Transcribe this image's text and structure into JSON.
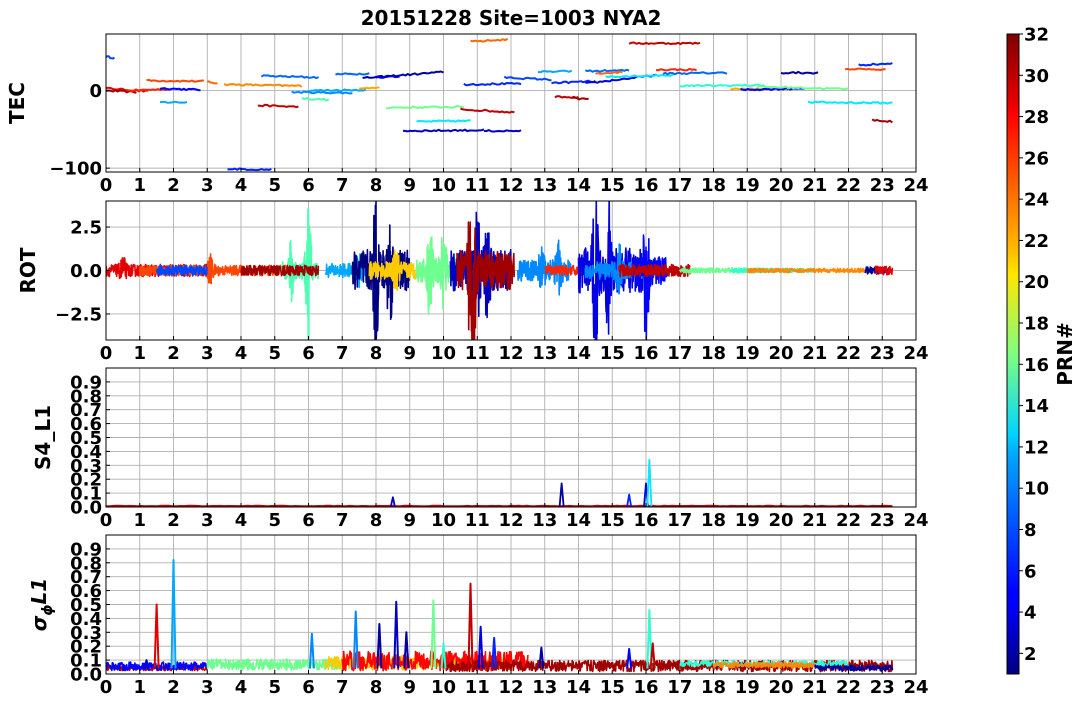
{
  "title": "20151228 Site=1003 NYA2",
  "colorbar": {
    "label": "PRN#",
    "min": 1,
    "max": 32,
    "ticks": [
      2,
      4,
      6,
      8,
      10,
      12,
      14,
      16,
      18,
      20,
      22,
      24,
      26,
      28,
      30,
      32
    ],
    "colormap": "jet"
  },
  "chart_data": [
    {
      "type": "line",
      "id": "tec",
      "ylabel": "TEC",
      "xlim": [
        0,
        24
      ],
      "ylim": [
        -105,
        73
      ],
      "xticks": [
        0,
        1,
        2,
        3,
        4,
        5,
        6,
        7,
        8,
        9,
        10,
        11,
        12,
        13,
        14,
        15,
        16,
        17,
        18,
        19,
        20,
        21,
        22,
        23,
        24
      ],
      "yticks": [
        -100,
        0
      ],
      "grid": true,
      "segments": [
        {
          "prn": 7,
          "x": [
            0.0,
            0.25
          ],
          "y": [
            44,
            42
          ]
        },
        {
          "prn": 29,
          "x": [
            0.0,
            1.25
          ],
          "y": [
            3,
            -1
          ]
        },
        {
          "prn": 31,
          "x": [
            0.0,
            0.9
          ],
          "y": [
            0,
            -2
          ]
        },
        {
          "prn": 27,
          "x": [
            0.6,
            1.9
          ],
          "y": [
            0,
            2
          ]
        },
        {
          "prn": 26,
          "x": [
            1.2,
            2.9
          ],
          "y": [
            13,
            12
          ]
        },
        {
          "prn": 10,
          "x": [
            1.6,
            2.4
          ],
          "y": [
            -15,
            -15
          ]
        },
        {
          "prn": 5,
          "x": [
            1.6,
            2.8
          ],
          "y": [
            3,
            1
          ]
        },
        {
          "prn": 25,
          "x": [
            3.0,
            3.3
          ],
          "y": [
            11,
            10
          ]
        },
        {
          "prn": 24,
          "x": [
            3.5,
            5.8
          ],
          "y": [
            8,
            6
          ]
        },
        {
          "prn": 6,
          "x": [
            3.6,
            4.9
          ],
          "y": [
            -101,
            -102
          ]
        },
        {
          "prn": 30,
          "x": [
            4.5,
            5.7
          ],
          "y": [
            -19,
            -21
          ]
        },
        {
          "prn": 8,
          "x": [
            4.6,
            6.3
          ],
          "y": [
            19,
            17
          ]
        },
        {
          "prn": 9,
          "x": [
            5.5,
            7.3
          ],
          "y": [
            -2,
            -3
          ]
        },
        {
          "prn": 15,
          "x": [
            5.8,
            6.6
          ],
          "y": [
            -10,
            -12
          ]
        },
        {
          "prn": 8,
          "x": [
            6.8,
            7.8
          ],
          "y": [
            21,
            22
          ]
        },
        {
          "prn": 10,
          "x": [
            6.0,
            7.7
          ],
          "y": [
            0,
            1
          ]
        },
        {
          "prn": 23,
          "x": [
            7.5,
            8.1
          ],
          "y": [
            2,
            5
          ]
        },
        {
          "prn": 2,
          "x": [
            7.6,
            10.0
          ],
          "y": [
            16,
            24
          ]
        },
        {
          "prn": 4,
          "x": [
            8.0,
            8.7
          ],
          "y": [
            17,
            18
          ]
        },
        {
          "prn": 16,
          "x": [
            8.3,
            10.6
          ],
          "y": [
            -22,
            -21
          ]
        },
        {
          "prn": 3,
          "x": [
            8.8,
            11.2
          ],
          "y": [
            -52,
            -51
          ]
        },
        {
          "prn": 12,
          "x": [
            9.2,
            10.8
          ],
          "y": [
            -40,
            -39
          ]
        },
        {
          "prn": 30,
          "x": [
            10.5,
            12.1
          ],
          "y": [
            -24,
            -28
          ]
        },
        {
          "prn": 6,
          "x": [
            10.6,
            12.3
          ],
          "y": [
            8,
            9
          ]
        },
        {
          "prn": 25,
          "x": [
            10.8,
            11.9
          ],
          "y": [
            63,
            66
          ]
        },
        {
          "prn": 3,
          "x": [
            11.2,
            12.3
          ],
          "y": [
            -52,
            -52
          ]
        },
        {
          "prn": 7,
          "x": [
            11.8,
            13.2
          ],
          "y": [
            17,
            14
          ]
        },
        {
          "prn": 10,
          "x": [
            12.8,
            13.8
          ],
          "y": [
            24,
            25
          ]
        },
        {
          "prn": 30,
          "x": [
            13.3,
            14.0
          ],
          "y": [
            -8,
            -9
          ]
        },
        {
          "prn": 6,
          "x": [
            13.2,
            14.5
          ],
          "y": [
            10,
            12
          ]
        },
        {
          "prn": 31,
          "x": [
            13.8,
            14.3
          ],
          "y": [
            -10,
            -11
          ]
        },
        {
          "prn": 4,
          "x": [
            14.2,
            16.3
          ],
          "y": [
            9,
            20
          ]
        },
        {
          "prn": 8,
          "x": [
            14.2,
            15.5
          ],
          "y": [
            25,
            26
          ]
        },
        {
          "prn": 25,
          "x": [
            14.5,
            15.3
          ],
          "y": [
            22,
            24
          ]
        },
        {
          "prn": 12,
          "x": [
            14.8,
            16.8
          ],
          "y": [
            18,
            20
          ]
        },
        {
          "prn": 30,
          "x": [
            15.5,
            17.6
          ],
          "y": [
            61,
            61
          ]
        },
        {
          "prn": 27,
          "x": [
            16.3,
            17.5
          ],
          "y": [
            27,
            27
          ]
        },
        {
          "prn": 8,
          "x": [
            16.5,
            18.4
          ],
          "y": [
            22,
            23
          ]
        },
        {
          "prn": 14,
          "x": [
            17.0,
            19.5
          ],
          "y": [
            6,
            7
          ]
        },
        {
          "prn": 23,
          "x": [
            18.5,
            20.2
          ],
          "y": [
            2,
            2
          ]
        },
        {
          "prn": 5,
          "x": [
            18.8,
            20.7
          ],
          "y": [
            1,
            3
          ]
        },
        {
          "prn": 16,
          "x": [
            19.3,
            22.0
          ],
          "y": [
            5,
            2
          ]
        },
        {
          "prn": 2,
          "x": [
            20.0,
            21.1
          ],
          "y": [
            23,
            23
          ]
        },
        {
          "prn": 12,
          "x": [
            20.8,
            23.3
          ],
          "y": [
            -15,
            -16
          ]
        },
        {
          "prn": 26,
          "x": [
            21.9,
            23.1
          ],
          "y": [
            28,
            27
          ]
        },
        {
          "prn": 6,
          "x": [
            22.3,
            23.3
          ],
          "y": [
            33,
            35
          ]
        },
        {
          "prn": 31,
          "x": [
            22.7,
            23.3
          ],
          "y": [
            -38,
            -40
          ]
        }
      ]
    },
    {
      "type": "line",
      "id": "rot",
      "ylabel": "ROT",
      "xlim": [
        0,
        24
      ],
      "ylim": [
        -4,
        4
      ],
      "xticks": [
        0,
        1,
        2,
        3,
        4,
        5,
        6,
        7,
        8,
        9,
        10,
        11,
        12,
        13,
        14,
        15,
        16,
        17,
        18,
        19,
        20,
        21,
        22,
        23,
        24
      ],
      "yticks": [
        -2.5,
        0.0,
        2.5
      ],
      "grid": true,
      "series": [
        {
          "prn": 29,
          "x": [
            0.0,
            3.0
          ],
          "amp": 0.35,
          "bursts": [
            [
              0.5,
              0.6
            ]
          ]
        },
        {
          "prn": 26,
          "x": [
            1.0,
            5.5
          ],
          "amp": 0.3,
          "bursts": [
            [
              3.1,
              0.7
            ]
          ]
        },
        {
          "prn": 7,
          "x": [
            1.5,
            3.0
          ],
          "amp": 0.3,
          "bursts": []
        },
        {
          "prn": 15,
          "x": [
            5.2,
            6.3
          ],
          "amp": 0.5,
          "bursts": [
            [
              5.5,
              1.6
            ],
            [
              6.0,
              3.6
            ]
          ]
        },
        {
          "prn": 31,
          "x": [
            4.0,
            6.3
          ],
          "amp": 0.3,
          "bursts": []
        },
        {
          "prn": 10,
          "x": [
            6.5,
            8.2
          ],
          "amp": 0.4,
          "bursts": [
            [
              7.5,
              0.9
            ]
          ]
        },
        {
          "prn": 1,
          "x": [
            7.3,
            9.0
          ],
          "amp": 1.2,
          "bursts": [
            [
              8.0,
              4.0
            ],
            [
              8.4,
              2.5
            ]
          ]
        },
        {
          "prn": 22,
          "x": [
            7.8,
            9.2
          ],
          "amp": 0.5,
          "bursts": [
            [
              8.6,
              1.0
            ]
          ]
        },
        {
          "prn": 16,
          "x": [
            9.2,
            10.6
          ],
          "amp": 0.7,
          "bursts": [
            [
              9.6,
              2.5
            ],
            [
              10.0,
              1.9
            ]
          ]
        },
        {
          "prn": 3,
          "x": [
            10.2,
            12.0
          ],
          "amp": 1.2,
          "bursts": [
            [
              11.0,
              2.6
            ],
            [
              11.3,
              2.3
            ]
          ]
        },
        {
          "prn": 31,
          "x": [
            10.4,
            12.1
          ],
          "amp": 1.1,
          "bursts": [
            [
              10.8,
              3.9
            ],
            [
              10.9,
              3.8
            ]
          ]
        },
        {
          "prn": 9,
          "x": [
            12.2,
            13.8
          ],
          "amp": 0.6,
          "bursts": [
            [
              12.9,
              1.6
            ],
            [
              13.4,
              1.2
            ]
          ]
        },
        {
          "prn": 27,
          "x": [
            13.0,
            14.2
          ],
          "amp": 0.3,
          "bursts": []
        },
        {
          "prn": 4,
          "x": [
            14.0,
            15.9
          ],
          "amp": 1.3,
          "bursts": [
            [
              14.5,
              4.0
            ],
            [
              14.9,
              3.2
            ]
          ]
        },
        {
          "prn": 9,
          "x": [
            14.2,
            16.0
          ],
          "amp": 0.5,
          "bursts": [
            [
              15.2,
              1.3
            ]
          ]
        },
        {
          "prn": 5,
          "x": [
            15.6,
            16.6
          ],
          "amp": 0.8,
          "bursts": [
            [
              16.0,
              3.6
            ]
          ]
        },
        {
          "prn": 30,
          "x": [
            15.2,
            17.3
          ],
          "amp": 0.35,
          "bursts": []
        },
        {
          "prn": 16,
          "x": [
            17.0,
            19.5
          ],
          "amp": 0.15,
          "bursts": []
        },
        {
          "prn": 14,
          "x": [
            18.5,
            21.0
          ],
          "amp": 0.12,
          "bursts": []
        },
        {
          "prn": 24,
          "x": [
            19.0,
            23.0
          ],
          "amp": 0.12,
          "bursts": []
        },
        {
          "prn": 2,
          "x": [
            22.5,
            23.2
          ],
          "amp": 0.2,
          "bursts": []
        },
        {
          "prn": 29,
          "x": [
            22.8,
            23.3
          ],
          "amp": 0.25,
          "bursts": []
        }
      ]
    },
    {
      "type": "line",
      "id": "s4",
      "ylabel": "S4_L1",
      "xlim": [
        0,
        24
      ],
      "ylim": [
        0,
        1
      ],
      "xticks": [
        0,
        1,
        2,
        3,
        4,
        5,
        6,
        7,
        8,
        9,
        10,
        11,
        12,
        13,
        14,
        15,
        16,
        17,
        18,
        19,
        20,
        21,
        22,
        23,
        24
      ],
      "yticks": [
        0.0,
        0.1,
        0.2,
        0.3,
        0.4,
        0.5,
        0.6,
        0.7,
        0.8,
        0.9
      ],
      "grid": true,
      "baseline": {
        "prn": 30,
        "x": [
          0.0,
          23.3
        ],
        "y": 0.005
      },
      "spikes": [
        {
          "prn": 3,
          "x": 8.5,
          "y": 0.07
        },
        {
          "prn": 2,
          "x": 13.5,
          "y": 0.17
        },
        {
          "prn": 6,
          "x": 15.5,
          "y": 0.09
        },
        {
          "prn": 4,
          "x": 16.0,
          "y": 0.17
        },
        {
          "prn": 12,
          "x": 16.1,
          "y": 0.34
        }
      ]
    },
    {
      "type": "line",
      "id": "sigma",
      "ylabel": "σφL1",
      "ylabel_main": "σ",
      "ylabel_sub": "ϕ",
      "ylabel_rest": "L1",
      "xlim": [
        0,
        24
      ],
      "ylim": [
        0,
        1
      ],
      "xticks": [
        0,
        1,
        2,
        3,
        4,
        5,
        6,
        7,
        8,
        9,
        10,
        11,
        12,
        13,
        14,
        15,
        16,
        17,
        18,
        19,
        20,
        21,
        22,
        23,
        24
      ],
      "yticks": [
        0.0,
        0.1,
        0.2,
        0.3,
        0.4,
        0.5,
        0.6,
        0.7,
        0.8,
        0.9
      ],
      "grid": true,
      "series": [
        {
          "prn": 30,
          "x": [
            0.0,
            3.0
          ],
          "base": 0.04,
          "noise": 0.02
        },
        {
          "prn": 5,
          "x": [
            0.0,
            3.0
          ],
          "base": 0.05,
          "noise": 0.03
        },
        {
          "prn": 16,
          "x": [
            3.0,
            7.0
          ],
          "base": 0.06,
          "noise": 0.04
        },
        {
          "prn": 22,
          "x": [
            6.5,
            12.0
          ],
          "base": 0.07,
          "noise": 0.05
        },
        {
          "prn": 28,
          "x": [
            7.0,
            12.5
          ],
          "base": 0.08,
          "noise": 0.07
        },
        {
          "prn": 31,
          "x": [
            10.0,
            23.3
          ],
          "base": 0.05,
          "noise": 0.04
        },
        {
          "prn": 14,
          "x": [
            17.0,
            22.0
          ],
          "base": 0.07,
          "noise": 0.02
        },
        {
          "prn": 24,
          "x": [
            18.0,
            21.0
          ],
          "base": 0.06,
          "noise": 0.02
        },
        {
          "prn": 2,
          "x": [
            21.0,
            23.3
          ],
          "base": 0.04,
          "noise": 0.02
        }
      ],
      "spikes": [
        {
          "prn": 4,
          "x": 1.2,
          "y": 0.1
        },
        {
          "prn": 29,
          "x": 1.5,
          "y": 0.5
        },
        {
          "prn": 10,
          "x": 2.0,
          "y": 0.82
        },
        {
          "prn": 9,
          "x": 6.1,
          "y": 0.29
        },
        {
          "prn": 9,
          "x": 7.4,
          "y": 0.45
        },
        {
          "prn": 2,
          "x": 8.1,
          "y": 0.36
        },
        {
          "prn": 3,
          "x": 8.6,
          "y": 0.52
        },
        {
          "prn": 2,
          "x": 8.9,
          "y": 0.3
        },
        {
          "prn": 16,
          "x": 9.7,
          "y": 0.53
        },
        {
          "prn": 14,
          "x": 10.0,
          "y": 0.22
        },
        {
          "prn": 30,
          "x": 10.8,
          "y": 0.65
        },
        {
          "prn": 4,
          "x": 11.1,
          "y": 0.34
        },
        {
          "prn": 6,
          "x": 11.5,
          "y": 0.26
        },
        {
          "prn": 2,
          "x": 12.9,
          "y": 0.19
        },
        {
          "prn": 5,
          "x": 15.5,
          "y": 0.18
        },
        {
          "prn": 14,
          "x": 16.1,
          "y": 0.46
        },
        {
          "prn": 30,
          "x": 16.2,
          "y": 0.22
        }
      ]
    }
  ]
}
